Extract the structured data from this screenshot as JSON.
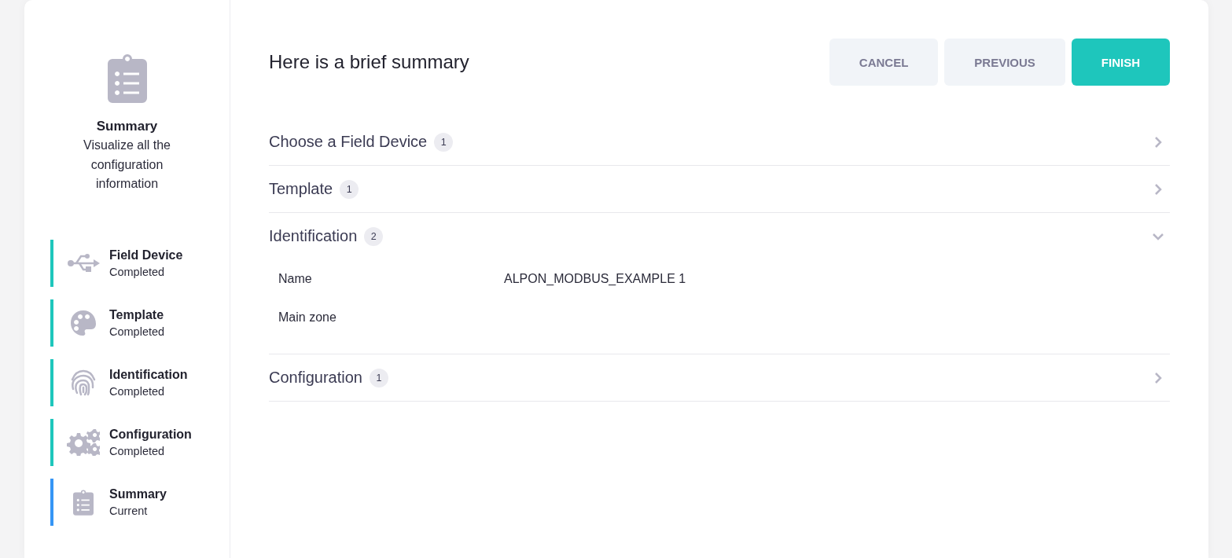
{
  "sidebar": {
    "header": {
      "title": "Summary",
      "description": "Visualize all the configuration information"
    },
    "steps": [
      {
        "kind": "usb",
        "title": "Field Device",
        "status": "Completed",
        "current": false
      },
      {
        "kind": "palette",
        "title": "Template",
        "status": "Completed",
        "current": false
      },
      {
        "kind": "fingerprint",
        "title": "Identification",
        "status": "Completed",
        "current": false
      },
      {
        "kind": "gears",
        "title": "Configuration",
        "status": "Completed",
        "current": false
      },
      {
        "kind": "clipboard",
        "title": "Summary",
        "status": "Current",
        "current": true
      }
    ]
  },
  "main": {
    "title": "Here is a brief summary",
    "buttons": [
      {
        "label": "CANCEL",
        "kind": "secondary"
      },
      {
        "label": "PREVIOUS",
        "kind": "secondary"
      },
      {
        "label": "FINISH",
        "kind": "primary"
      }
    ],
    "sections": [
      {
        "title": "Choose a Field Device",
        "count": "1",
        "expanded": false
      },
      {
        "title": "Template",
        "count": "1",
        "expanded": false
      },
      {
        "title": "Identification",
        "count": "2",
        "expanded": true,
        "fields": [
          {
            "label": "Name",
            "value": "ALPON_MODBUS_EXAMPLE 1"
          },
          {
            "label": "Main zone"
          }
        ]
      },
      {
        "title": "Configuration",
        "count": "1",
        "expanded": false
      }
    ]
  }
}
